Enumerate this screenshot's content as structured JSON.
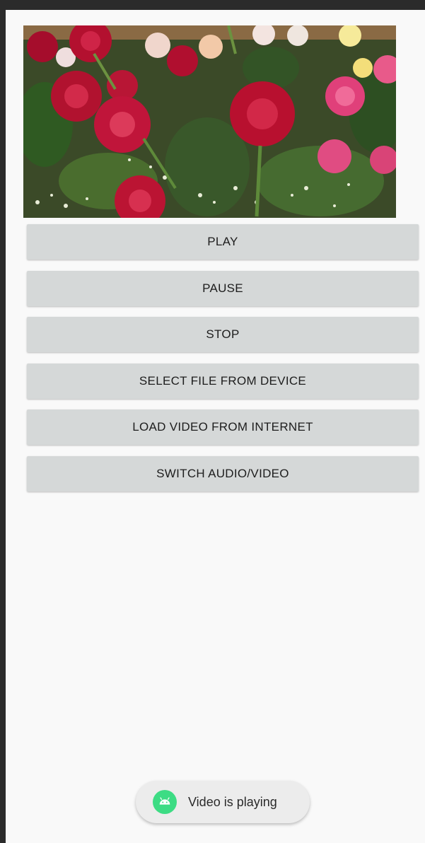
{
  "buttons": {
    "play": "PLAY",
    "pause": "PAUSE",
    "stop": "STOP",
    "select_file": "SELECT FILE FROM DEVICE",
    "load_internet": "LOAD VIDEO FROM INTERNET",
    "switch_av": "SWITCH AUDIO/VIDEO"
  },
  "toast": {
    "message": "Video is playing",
    "icon": "android-icon"
  },
  "colors": {
    "background": "#f9f9f9",
    "button": "#d5d8d8",
    "toast_icon": "#3ddc84"
  }
}
